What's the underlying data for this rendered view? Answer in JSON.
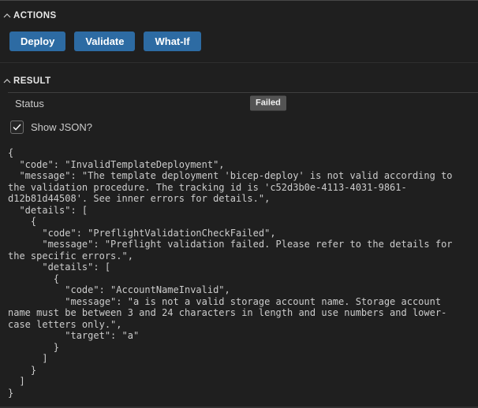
{
  "colors": {
    "page_bg": "#1f1f1f",
    "top_border": "#474747",
    "header_fg": "#e7e7e7",
    "button_bg": "#2d6ba3",
    "button_fg": "#ffffff",
    "divider": "#2e2e2e",
    "row_border": "#3f3f3f",
    "badge_bg": "#545454",
    "badge_fg": "#f0f0f0",
    "checkbox_border": "#6f6f6f",
    "json_fg": "#cccccc",
    "bottom_strip": "#2f2f2f"
  },
  "actions": {
    "title": "ACTIONS",
    "buttons": [
      {
        "label": "Deploy"
      },
      {
        "label": "Validate"
      },
      {
        "label": "What-If"
      }
    ]
  },
  "result": {
    "title": "RESULT",
    "status_label": "Status",
    "status_value": "Failed",
    "show_json_label": "Show JSON?",
    "show_json_checked": true,
    "json_output": "{\n  \"code\": \"InvalidTemplateDeployment\",\n  \"message\": \"The template deployment 'bicep-deploy' is not valid according to\nthe validation procedure. The tracking id is 'c52d3b0e-4113-4031-9861-\nd12b81d44508'. See inner errors for details.\",\n  \"details\": [\n    {\n      \"code\": \"PreflightValidationCheckFailed\",\n      \"message\": \"Preflight validation failed. Please refer to the details for\nthe specific errors.\",\n      \"details\": [\n        {\n          \"code\": \"AccountNameInvalid\",\n          \"message\": \"a is not a valid storage account name. Storage account\nname must be between 3 and 24 characters in length and use numbers and lower-\ncase letters only.\",\n          \"target\": \"a\"\n        }\n      ]\n    }\n  ]\n}"
  }
}
